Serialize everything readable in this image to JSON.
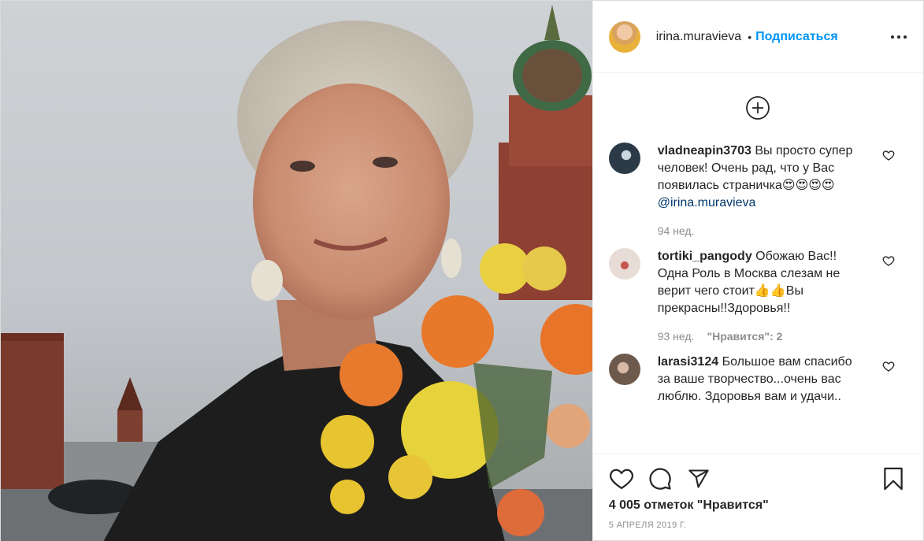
{
  "header": {
    "username": "irina.muravieva",
    "separator": "•",
    "follow_label": "Подписаться",
    "more_icon": "more-horizontal-icon"
  },
  "load_more_icon": "plus-circle-icon",
  "comments": [
    {
      "username": "vladneapin3703",
      "text": " Вы просто супер человек! Очень рад, что у Вас появилась страничка😍😍😍😍 ",
      "mention": "@irina.muravieva",
      "time": "94 нед.",
      "likes": "",
      "avatar_color": "#2b3a46"
    },
    {
      "username": "tortiki_pangody",
      "text": " Обожаю Вас!! Одна Роль в Москва слезам не верит чего стоит👍👍Вы прекрасны!!Здоровья!!",
      "mention": "",
      "time": "93 нед.",
      "likes": "\"Нравится\": 2",
      "avatar_color": "#d9c9c3"
    },
    {
      "username": "larasi3124",
      "text": " Большое вам спасибо за ваше творчество...очень вас люблю. Здоровья вам и удачи..",
      "mention": "",
      "time": "",
      "likes": "",
      "avatar_color": "#8a7a6c"
    }
  ],
  "actions": {
    "like_icon": "heart-icon",
    "comment_icon": "comment-icon",
    "share_icon": "paper-plane-icon",
    "save_icon": "bookmark-icon"
  },
  "likes_text": "4 005 отметок \"Нравится\"",
  "date": "5 апреля 2019 г.",
  "colors": {
    "accent": "#0095f6",
    "text": "#262626",
    "muted": "#8e8e8e",
    "border": "#dbdbdb"
  }
}
